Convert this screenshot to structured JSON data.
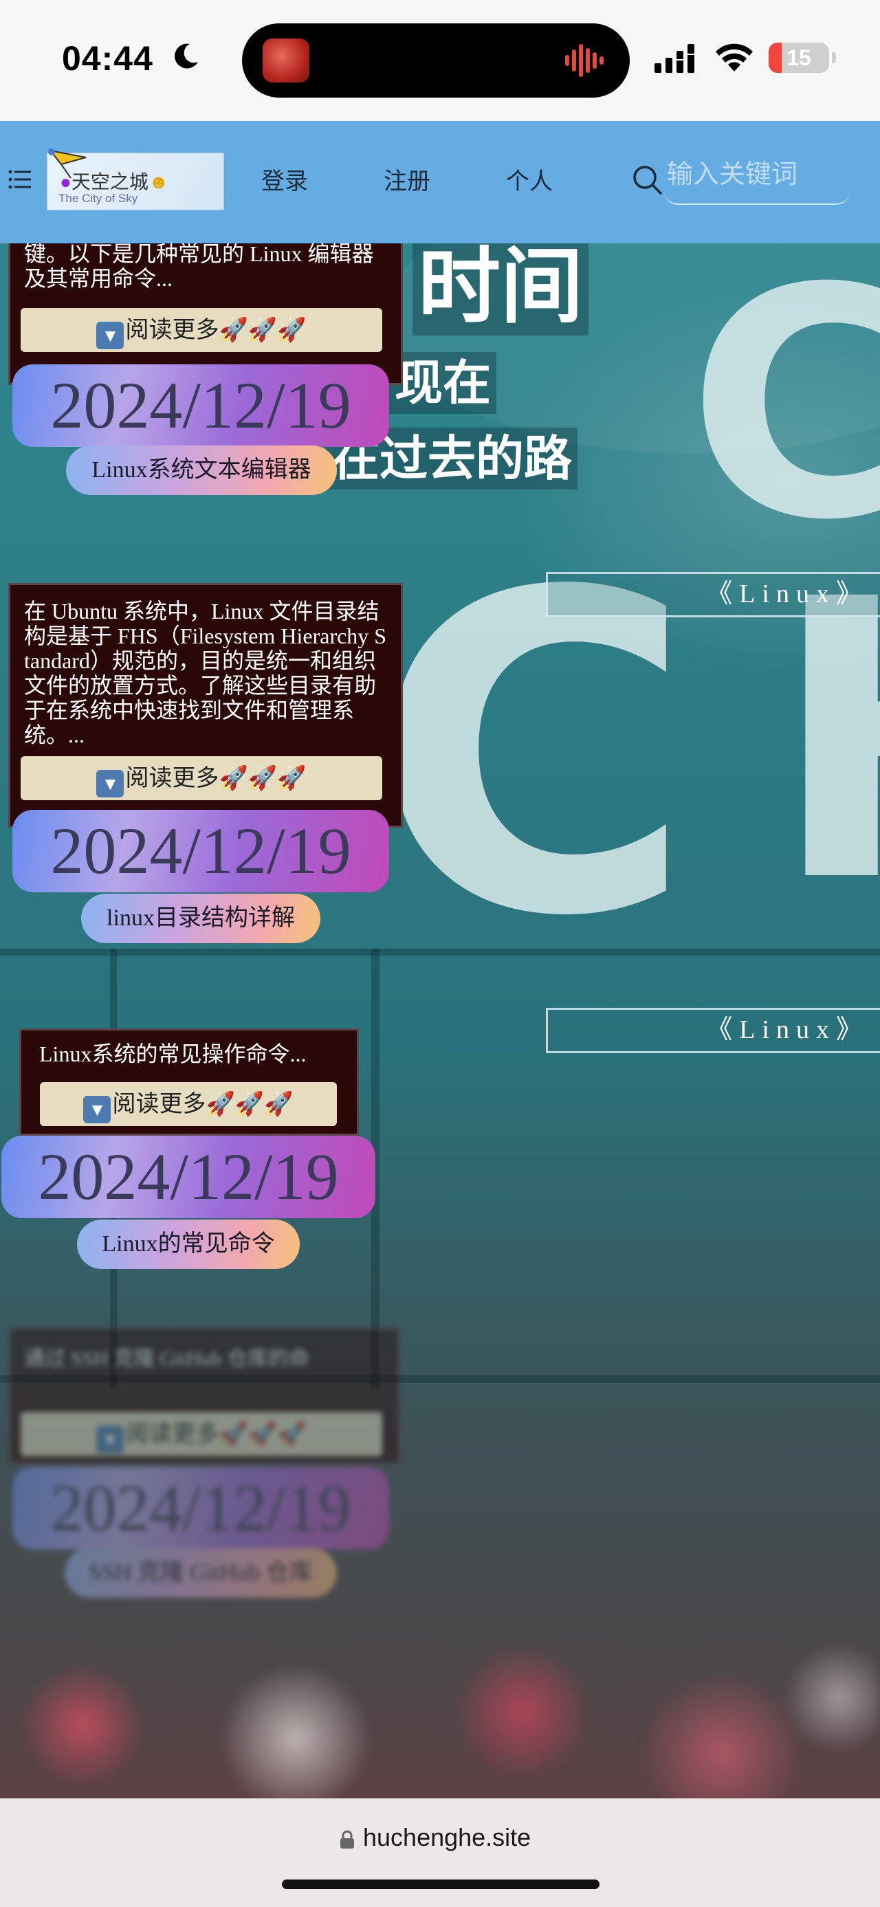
{
  "status_bar": {
    "time": "04:44",
    "battery_level": "15",
    "moon_icon": "moon-icon",
    "signal_icon": "cellular-signal-icon",
    "wifi_icon": "wifi-icon"
  },
  "nav": {
    "menu_icon": "hamburger-menu-icon",
    "logo_title": "天空之城",
    "logo_subtitle": "The City of Sky",
    "links": [
      "登录",
      "注册",
      "个人"
    ],
    "search_placeholder": "输入关键词",
    "search_icon": "search-icon"
  },
  "hero": {
    "line1": "时间",
    "line2": "现在",
    "line3": "在过去的路"
  },
  "posts": [
    {
      "excerpt": "等件编辑器都有其独特的命令和快捷键。以下是几种常见的 Linux 编辑器及其常用命令...",
      "read_more": "阅读更多🚀🚀🚀",
      "date": "2024/12/19",
      "title": "Linux系统文本编辑器",
      "tag": "《Linux》"
    },
    {
      "excerpt": "在 Ubuntu 系统中，Linux 文件目录结构是基于 FHS（Filesystem Hierarchy Standard）规范的，目的是统一和组织文件的放置方式。了解这些目录有助于在系统中快速找到文件和管理系统。...",
      "read_more": "阅读更多🚀🚀🚀",
      "date": "2024/12/19",
      "title": "linux目录结构详解",
      "tag": "《Linux》"
    },
    {
      "excerpt": "Linux系统的常见操作命令...",
      "read_more": "阅读更多🚀🚀🚀",
      "date": "2024/12/19",
      "title": "Linux的常见命令"
    },
    {
      "excerpt": "通过 SSH 克隆 GitHub 仓库的命",
      "read_more": "阅读更多🚀🚀🚀",
      "date": "2024/12/19",
      "title": "SSH 克隆 GitHub 仓库"
    }
  ],
  "browser": {
    "url": "huchenghe.site",
    "lock_icon": "lock-icon"
  },
  "colors": {
    "nav_bg": "#65ace2",
    "card_bg": "#2a0808",
    "read_more_bg": "#e6dcc0",
    "battery_low": "#f0463c"
  }
}
